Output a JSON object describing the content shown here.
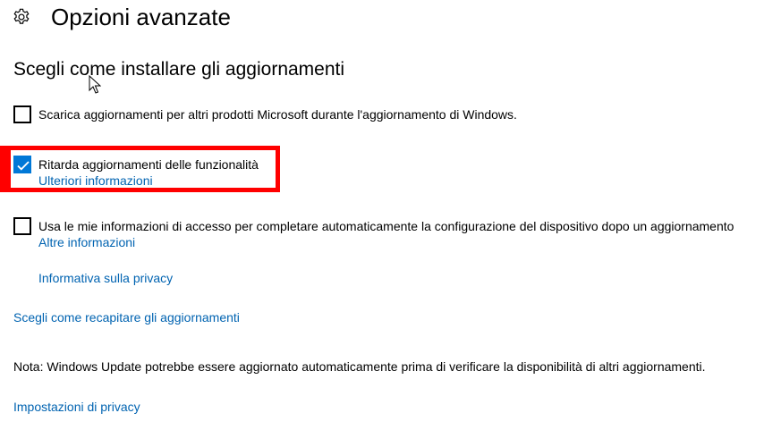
{
  "header": {
    "icon": "gear-icon",
    "title": "Opzioni avanzate"
  },
  "section": {
    "title": "Scegli come installare gli aggiornamenti"
  },
  "options": [
    {
      "label": "Scarica aggiornamenti per altri prodotti Microsoft durante l'aggiornamento di Windows.",
      "checked": false
    },
    {
      "label": "Ritarda aggiornamenti delle funzionalità",
      "checked": true,
      "link": "Ulteriori informazioni"
    },
    {
      "label": "Usa le mie informazioni di accesso per completare automaticamente la configurazione del dispositivo dopo un aggiornamento",
      "checked": false,
      "link": "Altre informazioni"
    }
  ],
  "links": {
    "privacy_statement": "Informativa sulla privacy",
    "delivery": "Scegli come recapitare gli aggiornamenti",
    "privacy_settings": "Impostazioni di privacy"
  },
  "note": "Nota: Windows Update potrebbe essere aggiornato automaticamente prima di verificare la disponibilità di altri aggiornamenti.",
  "colors": {
    "link": "#0063b1",
    "checkbox_checked": "#0078d7",
    "highlight": "#ff0000"
  }
}
